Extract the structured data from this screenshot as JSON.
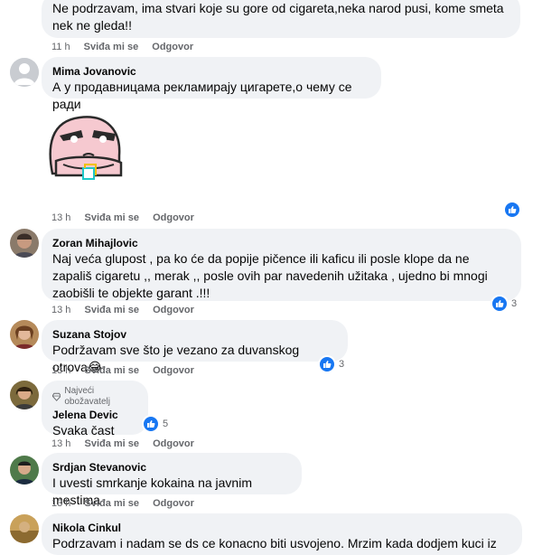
{
  "comments": [
    {
      "text": "Ne podrzavam, ima stvari koje su gore od cigareta,neka narod pusi, kome smeta nek ne gleda!!",
      "time": "11 h",
      "like_label": "Sviđa mi se",
      "reply_label": "Odgovor"
    },
    {
      "author": "Mima Jovanovic",
      "text": "А у продавницама рекламирају цигарете,о чему се ради",
      "sticker": "angry-sticker",
      "time": "13 h",
      "like_label": "Sviđa mi se",
      "reply_label": "Odgovor",
      "reaction_icon": "like-icon"
    },
    {
      "author": "Zoran Mihajlovic",
      "text": "Naj veća glupost , pa ko će da popije pičence ili kaficu ili posle klope da ne zapališ cigaretu ,, merak ,, posle ovih par navedenih užitaka , ujedno bi mnogi zaobišli te objekte garant .!!!",
      "time": "13 h",
      "like_label": "Sviđa mi se",
      "reply_label": "Odgovor",
      "reaction_count": "3"
    },
    {
      "author": "Suzana Stojov",
      "text": "Podržavam sve što je vezano za duvanskog otrova😂",
      "time": "13 h",
      "like_label": "Sviđa mi se",
      "reply_label": "Odgovor",
      "reaction_count": "3"
    },
    {
      "badge": "Najveći obožavatelj",
      "author": "Jelena Devic",
      "text": "Svaka čast",
      "time": "13 h",
      "like_label": "Sviđa mi se",
      "reply_label": "Odgovor",
      "reaction_count": "5"
    },
    {
      "author": "Srdjan Stevanovic",
      "text": "I uvesti smrkanje kokaina na javnim mestima",
      "time": "13 h",
      "like_label": "Sviđa mi se",
      "reply_label": "Odgovor"
    },
    {
      "author": "Nikola Cinkul",
      "text": "Podrzavam i nadam se ds ce konacno biti usvojeno. Mrzim kada dodjem kuci iz"
    }
  ],
  "colors": {
    "bubble": "#f0f2f5",
    "like_blue": "#1877f2",
    "meta": "#65676b"
  }
}
